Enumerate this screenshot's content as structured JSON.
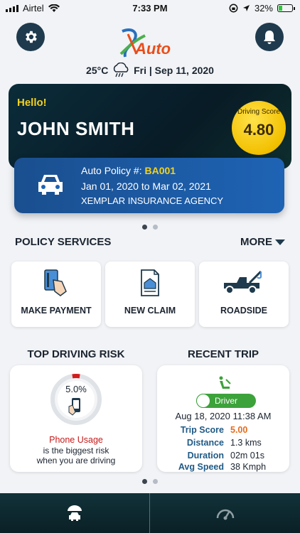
{
  "status_bar": {
    "carrier": "Airtel",
    "time": "7:33 PM",
    "battery": "32%",
    "battery_level": 0.32,
    "icons": [
      "signal-icon",
      "wifi-icon",
      "rotation-lock-icon",
      "location-arrow-icon",
      "battery-icon"
    ]
  },
  "header": {
    "logo_text": "Auto",
    "weather": {
      "temperature": "25°C",
      "date": "Fri | Sep 11, 2020",
      "icon": "cloud-rain-icon"
    },
    "settings_icon": "gear-icon",
    "notifications_icon": "bell-icon"
  },
  "greeting": {
    "hello": "Hello!",
    "name": "JOHN SMITH",
    "score_label": "Driving Score",
    "score_value": "4.80"
  },
  "policy": {
    "label": "Auto Policy #:",
    "number": "BA001",
    "period": "Jan 01, 2020 to Mar 02, 2021",
    "agency": "XEMPLAR INSURANCE AGENCY",
    "icon": "car-icon"
  },
  "services": {
    "title": "POLICY SERVICES",
    "more": "MORE",
    "items": [
      {
        "label": "MAKE PAYMENT",
        "icon": "card-payment-icon"
      },
      {
        "label": "NEW CLAIM",
        "icon": "claim-document-icon"
      },
      {
        "label": "ROADSIDE",
        "icon": "tow-truck-icon"
      }
    ]
  },
  "driving_risk": {
    "title": "TOP DRIVING RISK",
    "percent": "5.0%",
    "percent_value": 5.0,
    "risk_name": "Phone Usage",
    "line2": "is the biggest risk",
    "line3": "when you are driving",
    "icon": "phone-in-hand-icon"
  },
  "recent_trip": {
    "title": "RECENT TRIP",
    "mode": "Driver",
    "datetime": "Aug 18, 2020 11:38 AM",
    "rows": [
      {
        "key": "Trip Score",
        "value": "5.00"
      },
      {
        "key": "Distance",
        "value": "1.3 kms"
      },
      {
        "key": "Duration",
        "value": "02m 01s"
      },
      {
        "key": "Avg Speed",
        "value": "38 Kmph"
      }
    ],
    "icon": "driver-seat-icon"
  },
  "nav": {
    "items": [
      {
        "icon": "umbrella-car-icon"
      },
      {
        "icon": "speedometer-icon"
      }
    ]
  },
  "colors": {
    "accent_yellow": "#f3d21c",
    "policy_blue": "#1e63b4",
    "risk_red": "#c61a1a",
    "toggle_green": "#3ca23a",
    "nav_dark": "#0f2b32"
  }
}
